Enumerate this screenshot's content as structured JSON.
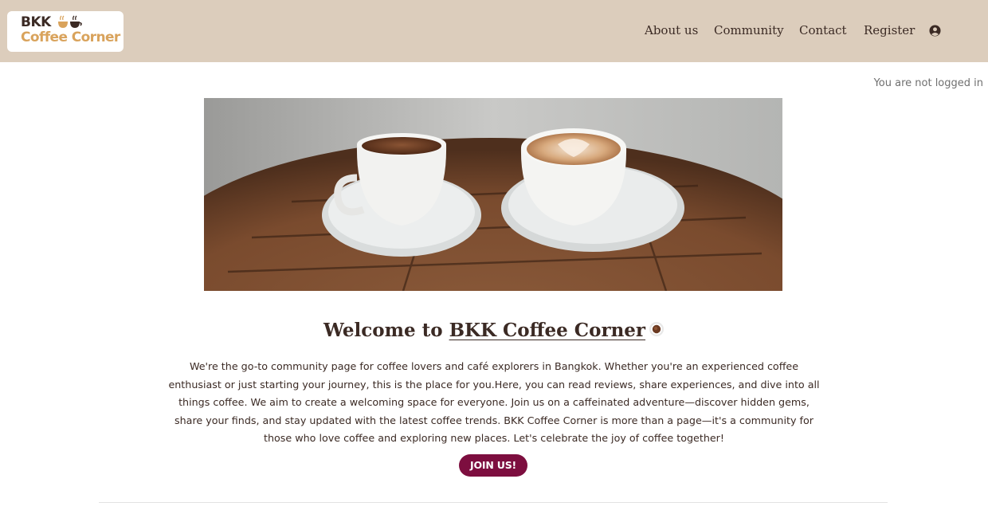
{
  "brand": {
    "line1": "BKK",
    "line2": "Coffee Corner"
  },
  "nav": {
    "items": [
      {
        "label": "About us"
      },
      {
        "label": "Community"
      },
      {
        "label": "Contact"
      },
      {
        "label": "Register"
      }
    ],
    "user_icon": "user-circle-icon"
  },
  "status": {
    "login": "You are not logged in"
  },
  "hero": {
    "image": "two-coffee-cups-on-wooden-table"
  },
  "welcome": {
    "prefix": "Welcome to",
    "link": "BKK Coffee Corner",
    "emoji_icon": "coffee-cup-icon"
  },
  "intro": {
    "text": "We're the go-to community page for coffee lovers and café explorers in Bangkok. Whether you're an experienced coffee enthusiast or just starting your journey, this is the place for you.Here, you can read reviews, share experiences, and dive into all things coffee. We aim to create a welcoming space for everyone. Join us on a caffeinated adventure—discover hidden gems, share your finds, and stay updated with the latest coffee trends. BKK Coffee Corner is more than a page—it's a community for those who love coffee and exploring new places. Let's celebrate the joy of coffee together!"
  },
  "cta": {
    "label": "JOIN US!"
  },
  "colors": {
    "header_bg": "#dccdbc",
    "brand_dark": "#3b2a24",
    "brand_gold": "#d9a35c",
    "cta_bg": "#7d0e3f"
  }
}
